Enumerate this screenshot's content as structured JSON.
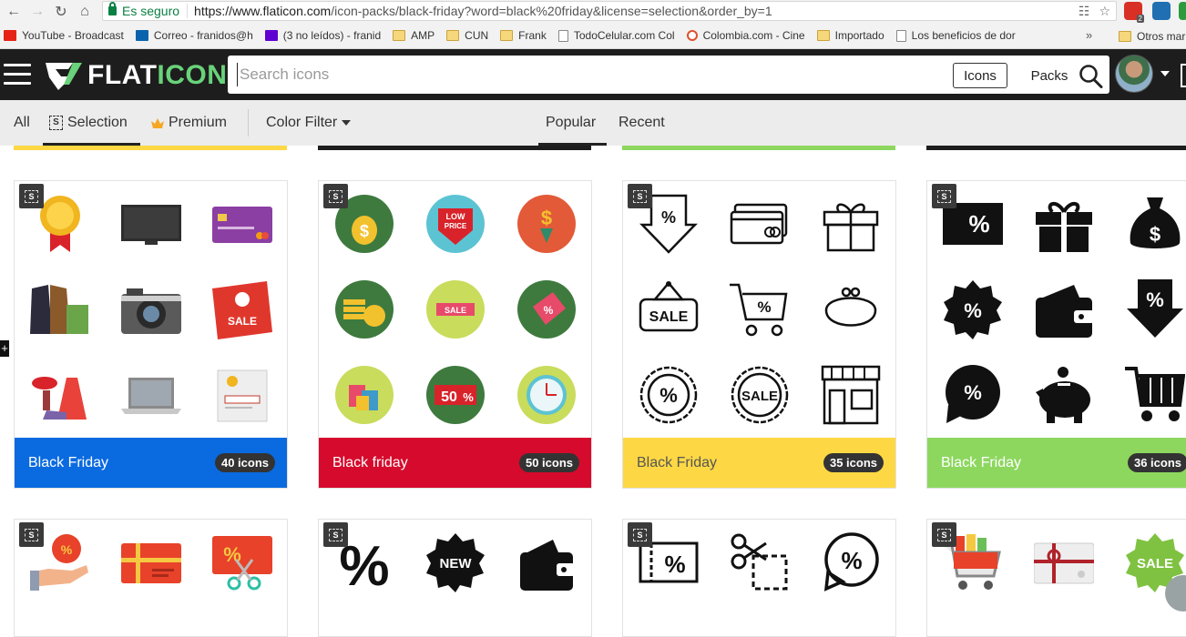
{
  "browser": {
    "secure_label": "Es seguro",
    "url_host": "https://www.flaticon.com",
    "url_path": "/icon-packs/black-friday?word=black%20friday&license=selection&order_by=1",
    "ext_badge": "2"
  },
  "bookmarks": {
    "items": [
      {
        "label": "YouTube - Broadcast",
        "icon": "youtube-icon"
      },
      {
        "label": "Correo - franidos@h",
        "icon": "outlook-icon"
      },
      {
        "label": "(3 no leídos) - franid",
        "icon": "yahoo-mail-icon"
      },
      {
        "label": "AMP",
        "icon": "folder-icon"
      },
      {
        "label": "CUN",
        "icon": "folder-icon"
      },
      {
        "label": "Frank",
        "icon": "folder-icon"
      },
      {
        "label": "TodoCelular.com Col",
        "icon": "page-icon"
      },
      {
        "label": "Colombia.com - Cine",
        "icon": "colombia-icon"
      },
      {
        "label": "Importado",
        "icon": "folder-icon"
      },
      {
        "label": "Los beneficios de dor",
        "icon": "page-icon"
      }
    ],
    "more": "»",
    "other": "Otros mar"
  },
  "header": {
    "logo_text_a": "FLAT",
    "logo_text_b": "ICON",
    "search_placeholder": "Search icons",
    "icons_btn": "Icons",
    "packs_btn": "Packs"
  },
  "filters": {
    "all": "All",
    "selection": "Selection",
    "premium": "Premium",
    "color_filter": "Color Filter",
    "popular": "Popular",
    "recent": "Recent",
    "sel_badge": "S"
  },
  "packs": [
    {
      "title": "Black Friday",
      "count": "40 icons",
      "color": "#0a6ae0",
      "text_color": "#ffffff"
    },
    {
      "title": "Black friday",
      "count": "50 icons",
      "color": "#d60a2c",
      "text_color": "#ffffff"
    },
    {
      "title": "Black Friday",
      "count": "35 icons",
      "color": "#fdd844",
      "text_color": "#555555"
    },
    {
      "title": "Black Friday",
      "count": "36 icons",
      "color": "#8dd75f",
      "text_color": "#ffffff"
    }
  ],
  "strip_colors": [
    "#fdd844",
    "#1d1d1d",
    "#8dd75f",
    "#1d1d1d"
  ],
  "icon_text": {
    "sale": "SALE",
    "low": "LOW",
    "price": "PRICE",
    "fifty": "50",
    "pct": "%",
    "new": "NEW",
    "dollar": "$"
  },
  "add_tab": "+"
}
